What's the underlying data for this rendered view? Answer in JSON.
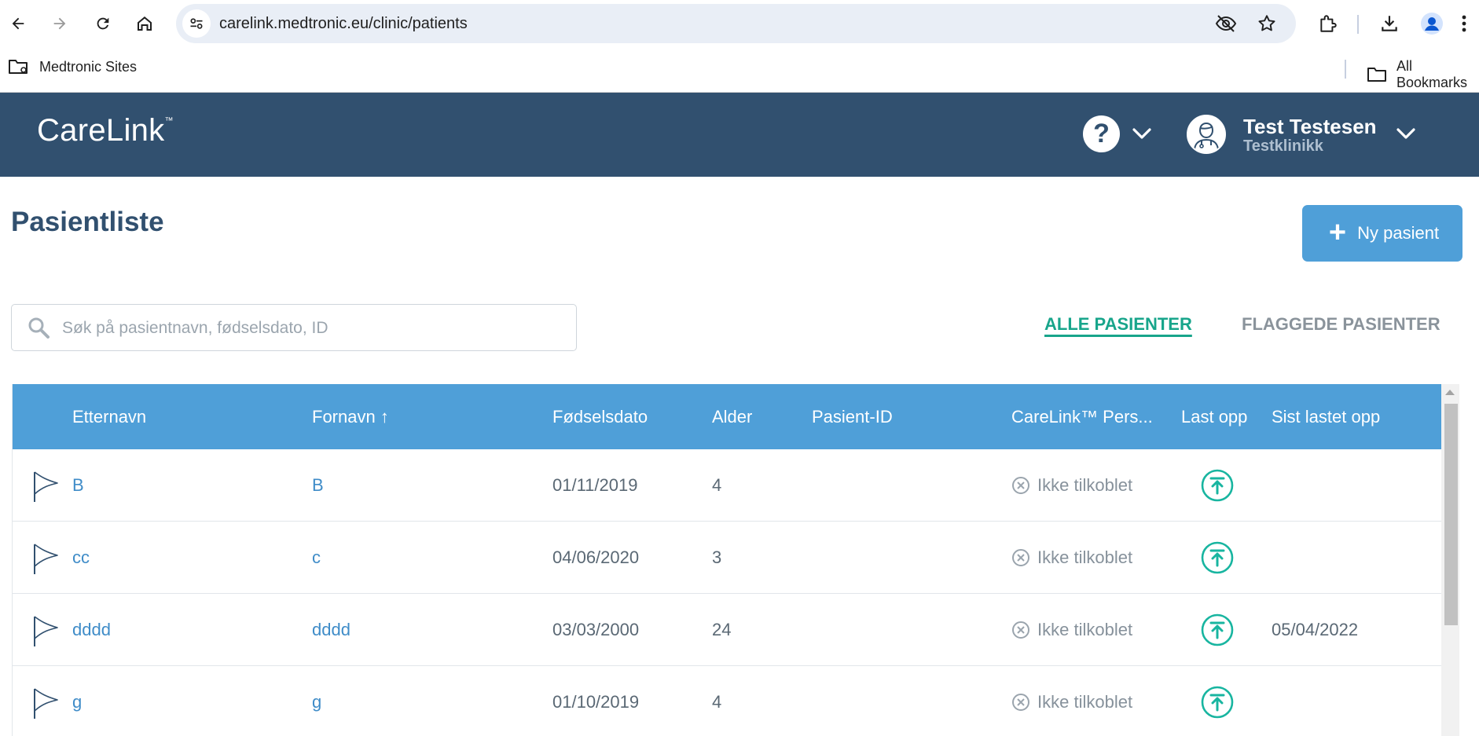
{
  "browser": {
    "url": "carelink.medtronic.eu/clinic/patients",
    "bookmarks": {
      "left_folder": "Medtronic Sites",
      "right_folder": "All Bookmarks"
    }
  },
  "header": {
    "logo": "CareLink",
    "logo_tm": "™",
    "help_symbol": "?",
    "user_name": "Test Testesen",
    "clinic": "Testklinikk"
  },
  "page": {
    "title": "Pasientliste",
    "new_patient_label": "Ny pasient",
    "search_placeholder": "Søk på pasientnavn, fødselsdato, ID",
    "tabs": {
      "all": "ALLE PASIENTER",
      "flagged": "FLAGGEDE PASIENTER"
    }
  },
  "table": {
    "columns": {
      "lastname": "Etternavn",
      "firstname": "Fornavn",
      "sort_indicator": "↑",
      "dob": "Fødselsdato",
      "age": "Alder",
      "patient_id": "Pasient-ID",
      "carelink": "CareLink™ Pers...",
      "upload": "Last opp",
      "last_upload": "Sist lastet opp"
    },
    "rows": [
      {
        "lastname": "B",
        "firstname": "B",
        "dob": "01/11/2019",
        "age": "4",
        "patient_id": "",
        "status": "Ikke tilkoblet",
        "last_upload": ""
      },
      {
        "lastname": "cc",
        "firstname": "c",
        "dob": "04/06/2020",
        "age": "3",
        "patient_id": "",
        "status": "Ikke tilkoblet",
        "last_upload": ""
      },
      {
        "lastname": "dddd",
        "firstname": "dddd",
        "dob": "03/03/2000",
        "age": "24",
        "patient_id": "",
        "status": "Ikke tilkoblet",
        "last_upload": "05/04/2022"
      },
      {
        "lastname": "g",
        "firstname": "g",
        "dob": "01/10/2019",
        "age": "4",
        "patient_id": "",
        "status": "Ikke tilkoblet",
        "last_upload": ""
      }
    ]
  },
  "colors": {
    "header_bg": "#31506f",
    "table_header_bg": "#4f9fd8",
    "accent_teal": "#18a58b",
    "link_blue": "#3f8cc8",
    "button_blue": "#4f9fd8"
  },
  "icons": [
    "back-arrow-icon",
    "forward-arrow-icon",
    "reload-icon",
    "home-icon",
    "site-settings-icon",
    "eye-off-icon",
    "star-icon",
    "extensions-icon",
    "download-icon",
    "profile-icon",
    "more-vert-icon",
    "folder-icon",
    "help-icon",
    "chevron-down-icon",
    "doctor-avatar-icon",
    "plus-icon",
    "search-icon",
    "flag-icon",
    "not-connected-icon",
    "upload-icon"
  ]
}
